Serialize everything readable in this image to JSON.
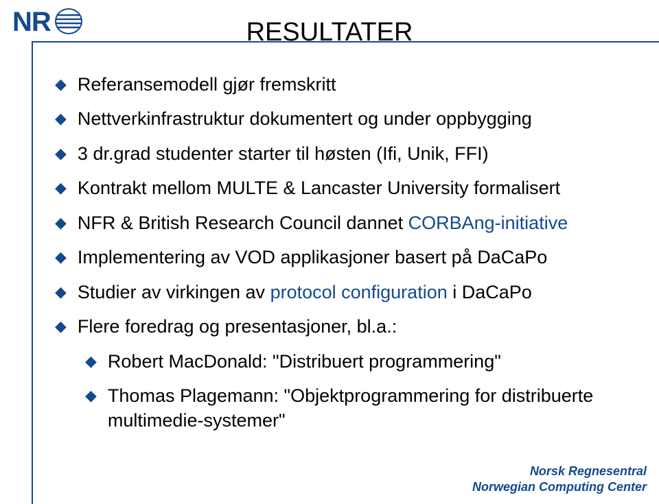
{
  "logo": {
    "text": "NR"
  },
  "slide": {
    "title": "RESULTATER",
    "bullets": [
      {
        "prefix": "Referansemodell gjør fremskritt",
        "hl": "",
        "suffix": ""
      },
      {
        "prefix": "Nettverkinfrastruktur dokumentert og under oppbygging",
        "hl": "",
        "suffix": ""
      },
      {
        "prefix": "3 dr.grad studenter starter til høsten (Ifi, Unik, FFI)",
        "hl": "",
        "suffix": ""
      },
      {
        "prefix": "Kontrakt mellom MULTE & Lancaster University formalisert",
        "hl": "",
        "suffix": ""
      },
      {
        "prefix": "NFR & British Research Council dannet ",
        "hl": "CORBAng-initiative",
        "suffix": ""
      },
      {
        "prefix": "Implementering av VOD applikasjoner basert på DaCaPo",
        "hl": "",
        "suffix": ""
      },
      {
        "prefix": "Studier av virkingen av ",
        "hl": "protocol configuration",
        "suffix": " i DaCaPo"
      },
      {
        "prefix": "Flere foredrag og presentasjoner, bl.a.:",
        "hl": "",
        "suffix": ""
      }
    ],
    "subbullets": [
      "Robert MacDonald: \"Distribuert programmering\"",
      "Thomas Plagemann: \"Objektprogrammering for distribuerte multimedie-systemer\""
    ]
  },
  "footer": {
    "line1": "Norsk Regnesentral",
    "line2": "Norwegian Computing Center"
  }
}
